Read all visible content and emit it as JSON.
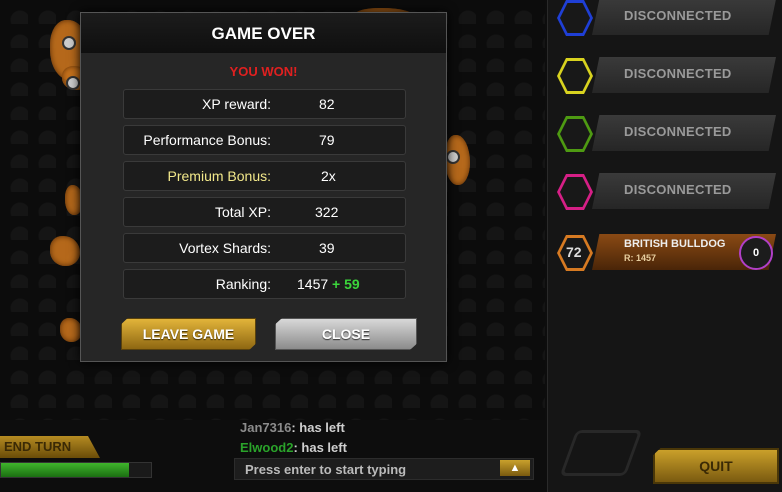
{
  "modal": {
    "title": "GAME OVER",
    "result": "YOU WON!",
    "stats": [
      {
        "label": "XP reward:",
        "value": "82"
      },
      {
        "label": "Performance Bonus:",
        "value": "79"
      },
      {
        "label": "Premium Bonus:",
        "value": "2x"
      },
      {
        "label": "Total XP:",
        "value": "322"
      },
      {
        "label": "Vortex Shards:",
        "value": "39"
      },
      {
        "label": "Ranking:",
        "value": "1457",
        "gain": "+ 59"
      }
    ],
    "leave_label": "LEAVE GAME",
    "close_label": "CLOSE"
  },
  "players": [
    {
      "status": "DISCONNECTED",
      "color": "#1f3fd6"
    },
    {
      "status": "DISCONNECTED",
      "color": "#d8d21f"
    },
    {
      "status": "DISCONNECTED",
      "color": "#4e9a12"
    },
    {
      "status": "DISCONNECTED",
      "color": "#d61f86"
    }
  ],
  "player_card": {
    "level": "72",
    "name": "BRITISH BULLDOG",
    "rank": "R: 1457",
    "count": "0"
  },
  "quit_label": "QUIT",
  "end_turn_label": "END TURN",
  "progress": 0.85,
  "chat": [
    {
      "user": "Jan7316",
      "message": ": has left"
    },
    {
      "user": "Elwood2",
      "message": ": has left"
    }
  ],
  "chat_input_placeholder": "Press enter to start typing",
  "colors": {
    "accent": "#c8731d",
    "won": "#e02020",
    "premium": "#f2e88a",
    "gain": "#3bd63b"
  }
}
